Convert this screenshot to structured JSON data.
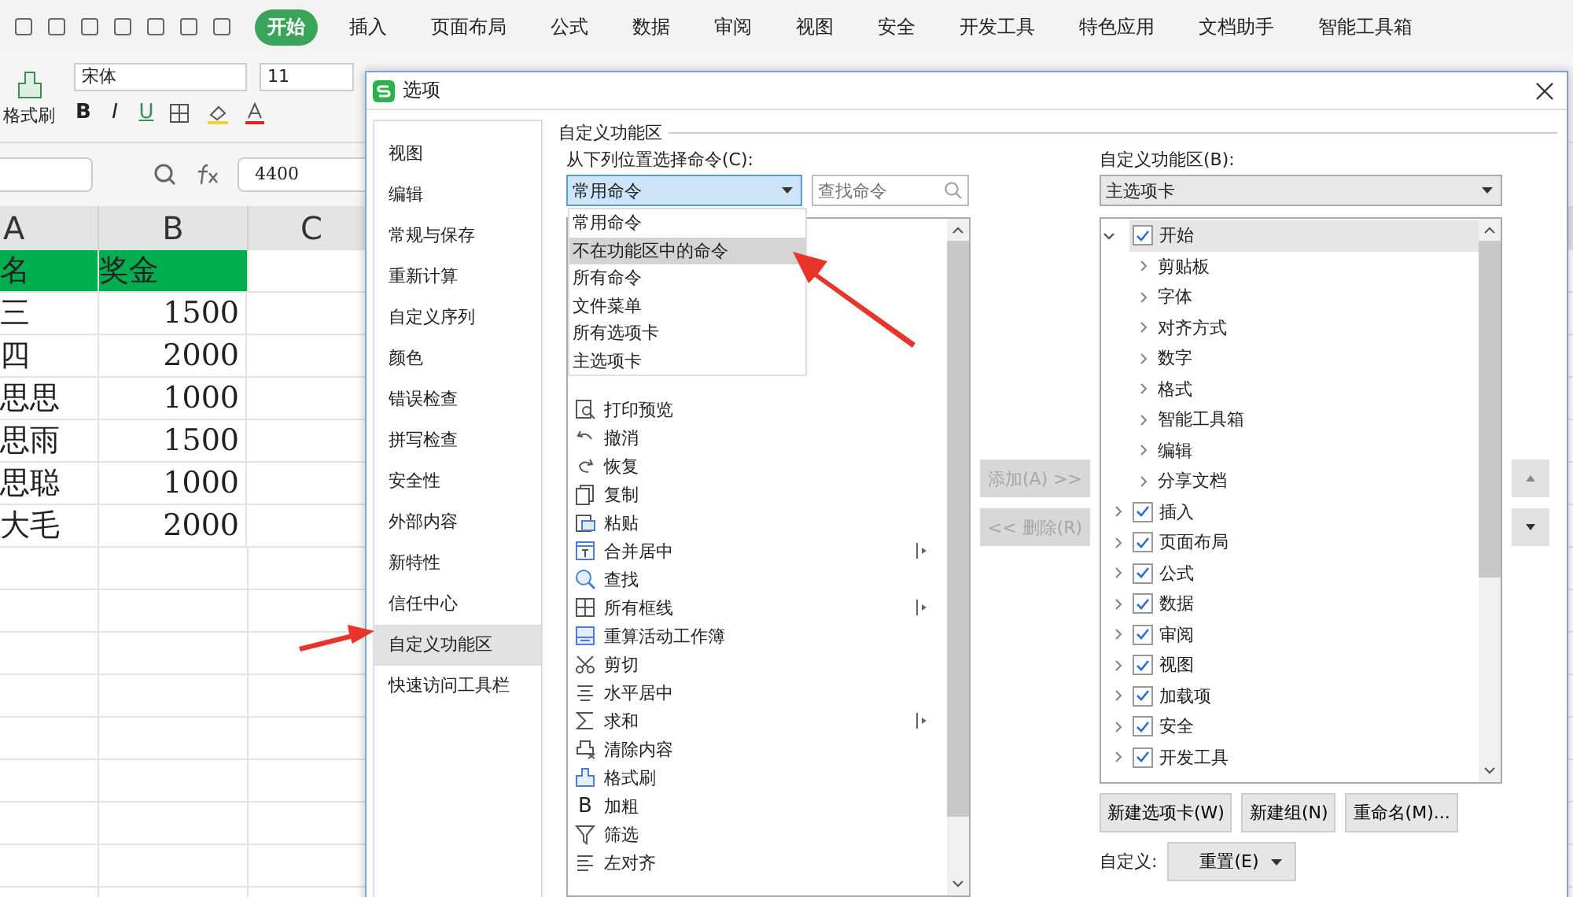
{
  "tabs": [
    {
      "label": "开始",
      "selected": true
    },
    {
      "label": "插入",
      "selected": false
    },
    {
      "label": "页面布局",
      "selected": false
    },
    {
      "label": "公式",
      "selected": false
    },
    {
      "label": "数据",
      "selected": false
    },
    {
      "label": "审阅",
      "selected": false
    },
    {
      "label": "视图",
      "selected": false
    },
    {
      "label": "安全",
      "selected": false
    },
    {
      "label": "开发工具",
      "selected": false
    },
    {
      "label": "特色应用",
      "selected": false
    },
    {
      "label": "文档助手",
      "selected": false
    },
    {
      "label": "智能工具箱",
      "selected": false
    }
  ],
  "ribbon": {
    "format_painter": "格式刷",
    "font_name": "宋体",
    "font_size": "11",
    "format_buttons": [
      "B",
      "I",
      "U"
    ]
  },
  "formula_bar": {
    "value": "4400"
  },
  "sheet": {
    "columns": [
      "A",
      "B",
      "C"
    ],
    "rows": [
      {
        "kind": "header",
        "cells": [
          "名",
          "奖金"
        ]
      },
      {
        "kind": "data",
        "cells": [
          "三",
          "1500"
        ]
      },
      {
        "kind": "data",
        "cells": [
          "四",
          "2000"
        ]
      },
      {
        "kind": "data",
        "cells": [
          "思思",
          "1000"
        ]
      },
      {
        "kind": "data",
        "cells": [
          "思雨",
          "1500"
        ]
      },
      {
        "kind": "data",
        "cells": [
          "思聪",
          "1000"
        ]
      },
      {
        "kind": "data",
        "cells": [
          "大毛",
          "2000"
        ]
      },
      {
        "kind": "empty",
        "cells": []
      },
      {
        "kind": "empty",
        "cells": []
      },
      {
        "kind": "empty",
        "cells": []
      },
      {
        "kind": "empty",
        "cells": []
      },
      {
        "kind": "empty",
        "cells": []
      },
      {
        "kind": "empty",
        "cells": []
      },
      {
        "kind": "empty",
        "cells": []
      },
      {
        "kind": "empty",
        "cells": []
      },
      {
        "kind": "empty",
        "cells": []
      }
    ]
  },
  "dialog": {
    "title": "选项",
    "nav": [
      {
        "label": "视图",
        "selected": false
      },
      {
        "label": "编辑",
        "selected": false
      },
      {
        "label": "常规与保存",
        "selected": false
      },
      {
        "label": "重新计算",
        "selected": false
      },
      {
        "label": "自定义序列",
        "selected": false
      },
      {
        "label": "颜色",
        "selected": false
      },
      {
        "label": "错误检查",
        "selected": false
      },
      {
        "label": "拼写检查",
        "selected": false
      },
      {
        "label": "安全性",
        "selected": false
      },
      {
        "label": "外部内容",
        "selected": false
      },
      {
        "label": "新特性",
        "selected": false
      },
      {
        "label": "信任中心",
        "selected": false
      },
      {
        "label": "自定义功能区",
        "selected": true
      },
      {
        "label": "快速访问工具栏",
        "selected": false
      }
    ],
    "section_title": "自定义功能区",
    "commands_label": "从下列位置选择命令(C):",
    "source_combo": {
      "value": "常用命令",
      "open": true
    },
    "search": {
      "placeholder": "查找命令"
    },
    "source_options": [
      {
        "label": "常用命令",
        "selected": false
      },
      {
        "label": "不在功能区中的命令",
        "selected": true
      },
      {
        "label": "所有命令",
        "selected": false
      },
      {
        "label": "文件菜单",
        "selected": false
      },
      {
        "label": "所有选项卡",
        "selected": false
      },
      {
        "label": "主选项卡",
        "selected": false
      }
    ],
    "commands": [
      {
        "label": "打印预览",
        "submenu": false
      },
      {
        "label": "撤消",
        "submenu": false
      },
      {
        "label": "恢复",
        "submenu": false
      },
      {
        "label": "复制",
        "submenu": false
      },
      {
        "label": "粘贴",
        "submenu": false
      },
      {
        "label": "合并居中",
        "submenu": true
      },
      {
        "label": "查找",
        "submenu": false
      },
      {
        "label": "所有框线",
        "submenu": true
      },
      {
        "label": "重算活动工作簿",
        "submenu": false
      },
      {
        "label": "剪切",
        "submenu": false
      },
      {
        "label": "水平居中",
        "submenu": false
      },
      {
        "label": "求和",
        "submenu": true
      },
      {
        "label": "清除内容",
        "submenu": false
      },
      {
        "label": "格式刷",
        "submenu": false
      },
      {
        "label": "加粗",
        "submenu": false,
        "glyph": "B"
      },
      {
        "label": "筛选",
        "submenu": false
      },
      {
        "label": "左对齐",
        "submenu": false
      }
    ],
    "add_button": {
      "label": "添加(A) >>",
      "disabled": true
    },
    "remove_button": {
      "label": "<< 删除(R)",
      "disabled": true
    },
    "ribbon_label": "自定义功能区(B):",
    "target_combo": {
      "value": "主选项卡"
    },
    "tree": [
      {
        "label": "开始",
        "checked": true,
        "expanded": true,
        "selected": true,
        "children": [
          {
            "label": "剪贴板"
          },
          {
            "label": "字体"
          },
          {
            "label": "对齐方式"
          },
          {
            "label": "数字"
          },
          {
            "label": "格式"
          },
          {
            "label": "智能工具箱"
          },
          {
            "label": "编辑"
          },
          {
            "label": "分享文档"
          }
        ]
      },
      {
        "label": "插入",
        "checked": true,
        "expanded": false,
        "selected": false
      },
      {
        "label": "页面布局",
        "checked": true,
        "expanded": false,
        "selected": false
      },
      {
        "label": "公式",
        "checked": true,
        "expanded": false,
        "selected": false
      },
      {
        "label": "数据",
        "checked": true,
        "expanded": false,
        "selected": false
      },
      {
        "label": "审阅",
        "checked": true,
        "expanded": false,
        "selected": false
      },
      {
        "label": "视图",
        "checked": true,
        "expanded": false,
        "selected": false
      },
      {
        "label": "加载项",
        "checked": true,
        "expanded": false,
        "selected": false
      },
      {
        "label": "安全",
        "checked": true,
        "expanded": false,
        "selected": false
      },
      {
        "label": "开发工具",
        "checked": true,
        "expanded": false,
        "selected": false
      }
    ],
    "tree_buttons": [
      "新建选项卡(W)",
      "新建组(N)",
      "重命名(M)..."
    ],
    "customize_label": "自定义:",
    "reset_button": {
      "label": "重置(E)"
    }
  }
}
